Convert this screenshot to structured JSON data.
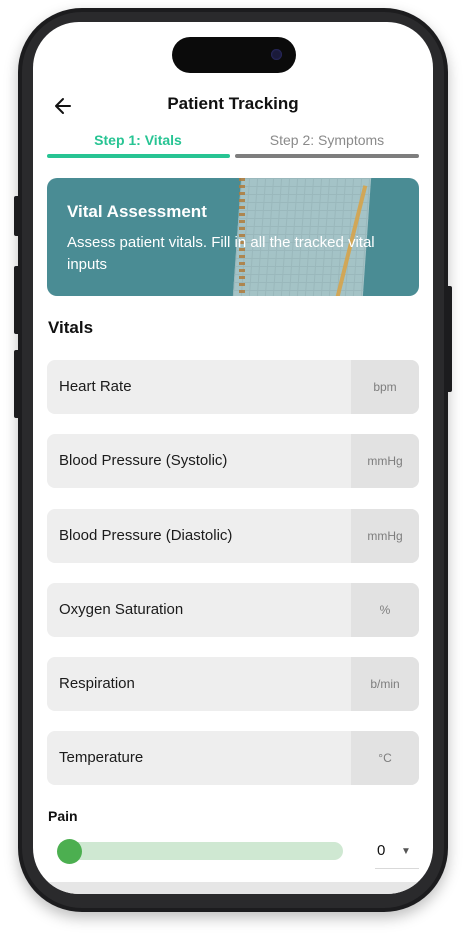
{
  "header": {
    "title": "Patient Tracking",
    "back_icon": "arrow-left-icon"
  },
  "steps": [
    {
      "label": "Step 1: Vitals",
      "active": true,
      "color": "#27c493"
    },
    {
      "label": "Step 2: Symptoms",
      "active": false,
      "color": "#8a8a8a"
    }
  ],
  "banner": {
    "title": "Vital Assessment",
    "subtitle": "Assess patient vitals. Fill in all the tracked vital inputs",
    "background": "#4a8c94"
  },
  "section_title": "Vitals",
  "fields": [
    {
      "label": "Heart Rate",
      "unit": "bpm"
    },
    {
      "label": "Blood Pressure (Systolic)",
      "unit": "mmHg"
    },
    {
      "label": "Blood Pressure (Diastolic)",
      "unit": "mmHg"
    },
    {
      "label": "Oxygen Saturation",
      "unit": "%"
    },
    {
      "label": "Respiration",
      "unit": "b/min"
    },
    {
      "label": "Temperature",
      "unit": "°C"
    }
  ],
  "pain": {
    "label": "Pain",
    "value": "0",
    "slider_fraction": 0.0,
    "accent": "#4caf50"
  }
}
